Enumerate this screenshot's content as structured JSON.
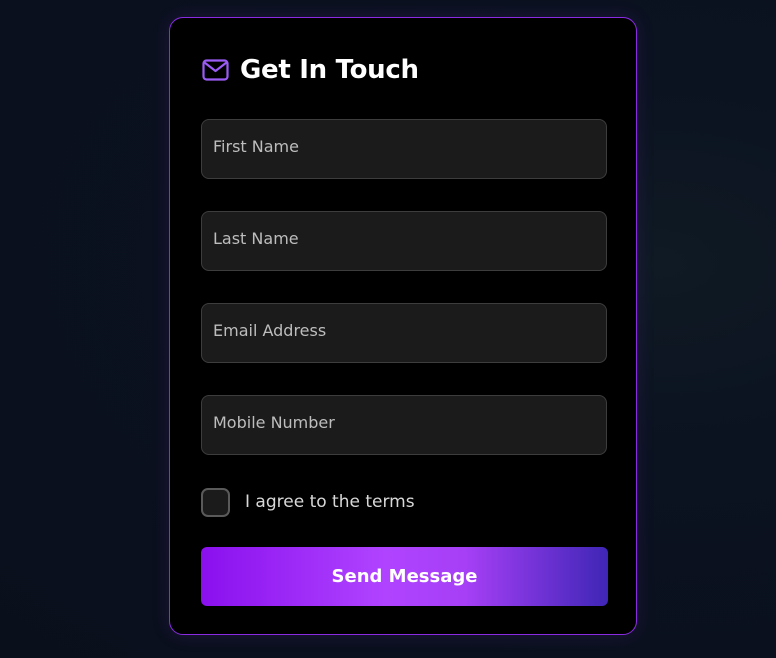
{
  "form": {
    "title": "Get In Touch",
    "icon": "envelope-icon",
    "fields": [
      {
        "placeholder": "First Name",
        "value": ""
      },
      {
        "placeholder": "Last Name",
        "value": ""
      },
      {
        "placeholder": "Email Address",
        "value": ""
      },
      {
        "placeholder": "Mobile Number",
        "value": ""
      }
    ],
    "terms_checked": false,
    "terms_label": "I agree to the terms",
    "submit_label": "Send Message"
  },
  "colors": {
    "accent": "#8a2be2",
    "card_background": "#000000",
    "field_background": "#1b1b1b",
    "page_background": "#0a0f1c"
  }
}
